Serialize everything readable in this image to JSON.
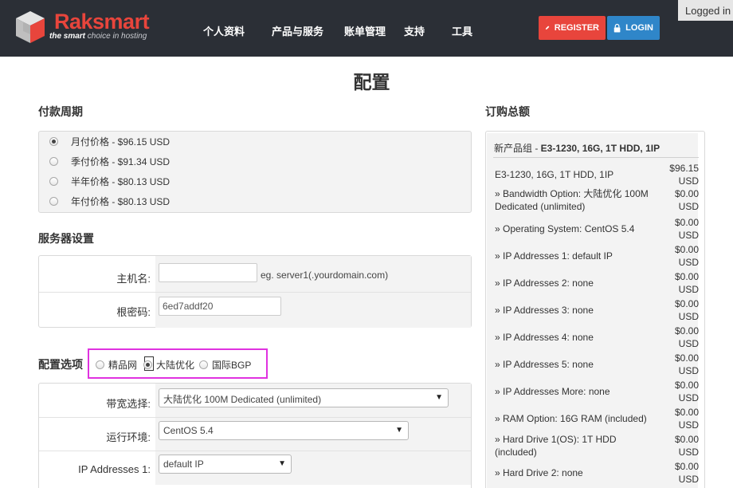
{
  "header": {
    "brand_main": "Raksmart",
    "tagline_em": "the smart",
    "tagline_rest": " choice in hosting",
    "nav": [
      "个人资料",
      "产品与服务",
      "账单管理",
      "支持",
      "工具"
    ],
    "register_label": "REGISTER",
    "login_label": "LOGIN",
    "logged_in": "Logged in",
    "colors": {
      "bg": "#2b2f36",
      "register": "#e8453c",
      "login": "#2f86c9"
    }
  },
  "page_title": "配置",
  "billing": {
    "title": "付款周期",
    "options": [
      {
        "label": "月付价格 - $96.15 USD",
        "checked": true
      },
      {
        "label": "季付价格 - $91.34 USD",
        "checked": false
      },
      {
        "label": "半年价格 - $80.13 USD",
        "checked": false
      },
      {
        "label": "年付价格 - $80.13 USD",
        "checked": false
      }
    ]
  },
  "server": {
    "title": "服务器设置",
    "hostname_label": "主机名:",
    "hostname_value": "",
    "hostname_hint": "eg. server1(.yourdomain.com)",
    "rootpw_label": "根密码:",
    "rootpw_value": "6ed7addf20"
  },
  "config": {
    "title": "配置选项",
    "network_options": [
      {
        "label": "精品网",
        "checked": false
      },
      {
        "label": "大陆优化",
        "checked": true
      },
      {
        "label": "国际BGP",
        "checked": false
      }
    ],
    "bandwidth_label": "带宽选择:",
    "bandwidth_value": "大陆优化 100M Dedicated (unlimited)",
    "os_label": "运行环境:",
    "os_value": "CentOS 5.4",
    "ip_label": "IP Addresses 1:",
    "ip_value": "default IP",
    "highlight_color": "#e032e0"
  },
  "summary": {
    "title": "订购总额",
    "group_prefix": "新产品组 - ",
    "group_name": "E3-1230, 16G, 1T HDD, 1IP",
    "items": [
      {
        "desc": "E3-1230, 16G, 1T HDD, 1IP",
        "price": "$96.15 USD"
      },
      {
        "desc": "» Bandwidth Option: 大陆优化 100M Dedicated (unlimited)",
        "price": "$0.00 USD"
      },
      {
        "desc": "» Operating System: CentOS 5.4",
        "price": "$0.00 USD"
      },
      {
        "desc": "» IP Addresses 1: default IP",
        "price": "$0.00 USD"
      },
      {
        "desc": "» IP Addresses 2: none",
        "price": "$0.00 USD"
      },
      {
        "desc": "» IP Addresses 3: none",
        "price": "$0.00 USD"
      },
      {
        "desc": "» IP Addresses 4: none",
        "price": "$0.00 USD"
      },
      {
        "desc": "» IP Addresses 5: none",
        "price": "$0.00 USD"
      },
      {
        "desc": "» IP Addresses More: none",
        "price": "$0.00 USD"
      },
      {
        "desc": "» RAM Option: 16G RAM (included)",
        "price": "$0.00 USD"
      },
      {
        "desc": "» Hard Drive 1(OS): 1T HDD (included)",
        "price": "$0.00 USD"
      },
      {
        "desc": "» Hard Drive 2: none",
        "price": "$0.00 USD"
      }
    ]
  }
}
